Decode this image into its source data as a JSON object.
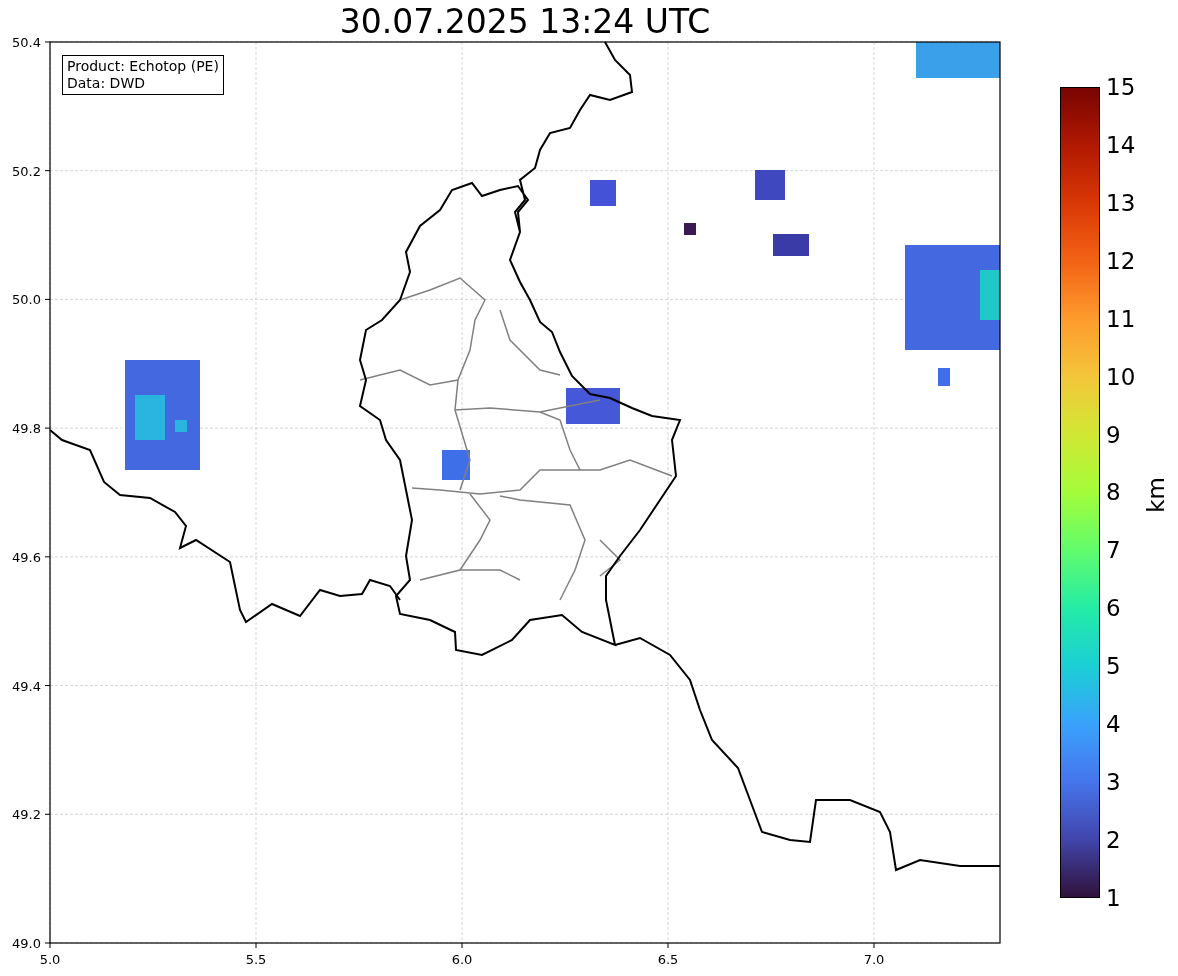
{
  "title": "30.07.2025 13:24 UTC",
  "info_box": {
    "lines": [
      "Product: Echotop (PE)",
      "Data: DWD"
    ]
  },
  "map": {
    "xticks": [
      "5.0",
      "5.5",
      "6.0",
      "6.5",
      "7.0"
    ],
    "yticks": [
      "50.4",
      "50.2",
      "50.0",
      "49.8",
      "49.6",
      "49.4",
      "49.2",
      "49.0"
    ]
  },
  "colorbar": {
    "label": "km",
    "ticks": [
      "15",
      "14",
      "13",
      "12",
      "11",
      "10",
      "9",
      "8",
      "7",
      "6",
      "5",
      "4",
      "3",
      "2",
      "1"
    ]
  }
}
